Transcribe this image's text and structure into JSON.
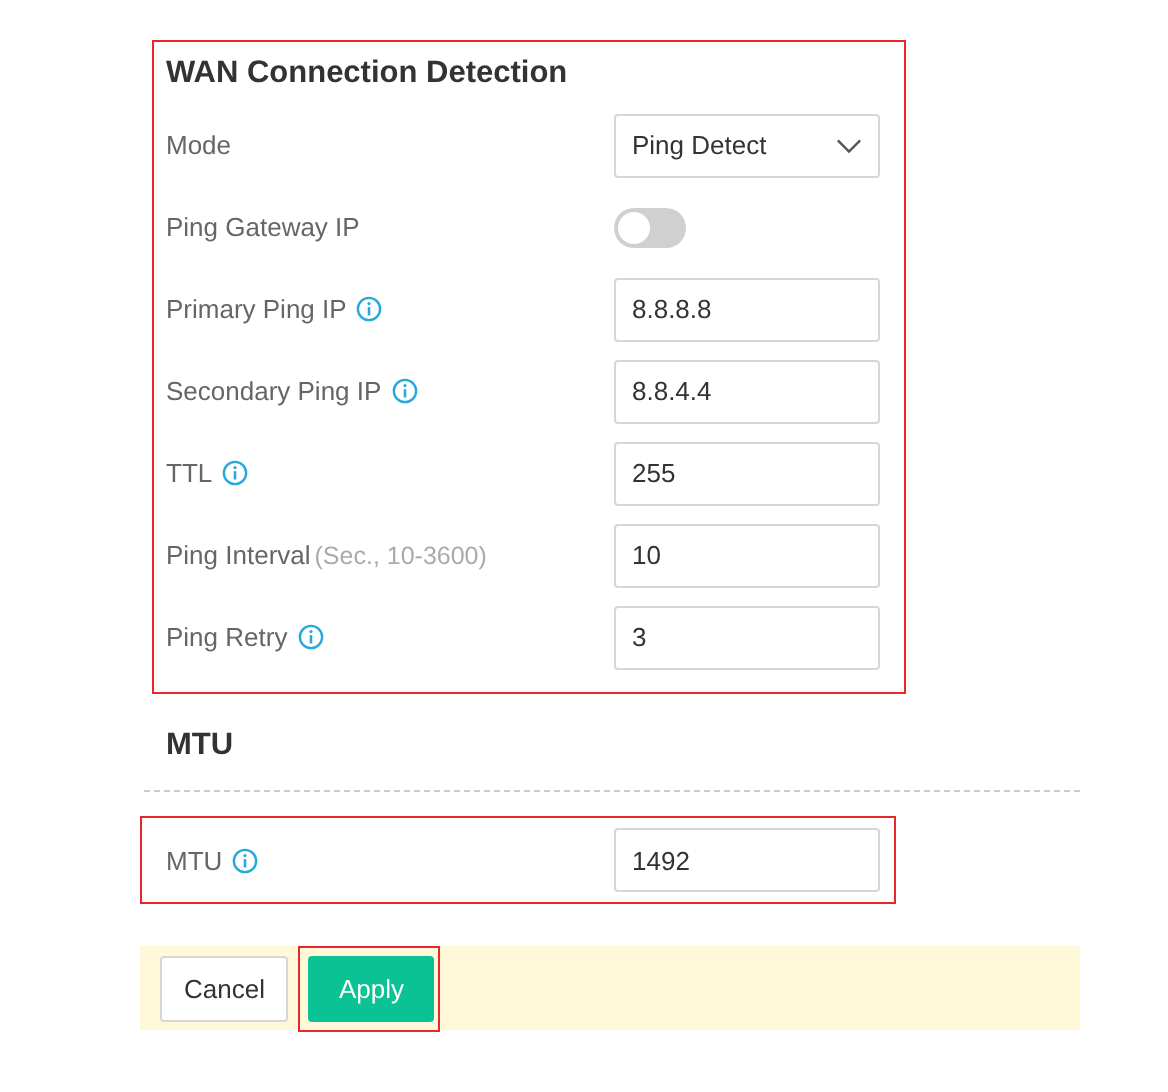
{
  "wan_detection": {
    "title": "WAN Connection Detection",
    "highlighted": true,
    "rows": [
      {
        "kind": "select",
        "label": "Mode",
        "info": false,
        "value": "Ping Detect"
      },
      {
        "kind": "toggle",
        "label": "Ping Gateway IP",
        "info": false,
        "on": false
      },
      {
        "kind": "text",
        "label": "Primary Ping IP",
        "info": true,
        "value": "8.8.8.8"
      },
      {
        "kind": "text",
        "label": "Secondary Ping IP",
        "info": true,
        "value": "8.8.4.4"
      },
      {
        "kind": "text",
        "label": "TTL",
        "info": true,
        "value": "255"
      },
      {
        "kind": "text",
        "label": "Ping Interval",
        "hint": "(Sec., 10-3600)",
        "info": false,
        "value": "10"
      },
      {
        "kind": "text",
        "label": "Ping Retry",
        "info": true,
        "value": "3"
      }
    ]
  },
  "mtu": {
    "title": "MTU",
    "highlighted": true,
    "row": {
      "kind": "text",
      "label": "MTU",
      "info": true,
      "value": "1492"
    }
  },
  "footer": {
    "buttons": [
      {
        "kind": "secondary",
        "label": "Cancel",
        "highlighted": false
      },
      {
        "kind": "primary",
        "label": "Apply",
        "highlighted": true
      }
    ]
  }
}
